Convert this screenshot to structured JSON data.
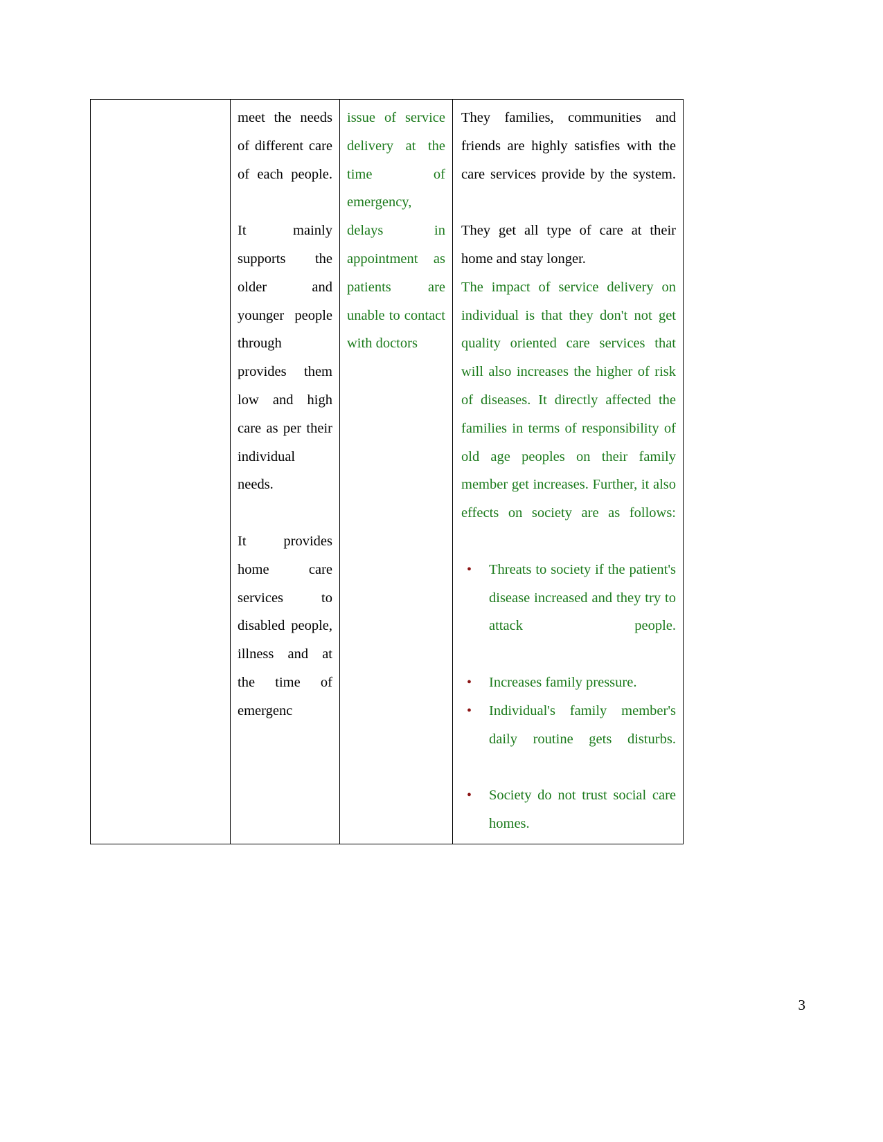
{
  "document": {
    "page_number": "3",
    "colors": {
      "body_text": "#000000",
      "green_text": "#1b7a1b",
      "bullet_marker": "#8c1515",
      "table_border": "#000000",
      "page_background": "#ffffff"
    }
  },
  "table": {
    "columns": [
      {
        "name": "column-1-empty",
        "content": ""
      },
      {
        "name": "column-2-black-text",
        "content": ""
      },
      {
        "name": "column-3-green-text",
        "content": ""
      },
      {
        "name": "column-4-main-text",
        "content": ""
      }
    ],
    "row": {
      "cell_1": {
        "text": ""
      },
      "cell_2": {
        "paragraph_1": "meet the needs of different care of each people.",
        "paragraph_2": "It mainly supports the older and younger people through provides them low and high care as per their individual needs.",
        "paragraph_3": "It provides home care services to disabled people, illness and at the time of emergenc"
      },
      "cell_3": {
        "paragraph_1": "issue of service delivery at the time of emergency, delays in appointment as patients are unable to contact with doctors"
      },
      "cell_4": {
        "paragraph_1": "They families, communities and friends are highly satisfies with the care services provide by the system.",
        "paragraph_2": "They get all type of care at their home and stay longer.",
        "paragraph_3": "The impact of service delivery on individual is that they don't not get quality oriented care services that will also increases the higher of risk of diseases. It directly affected the families in terms of responsibility of old age peoples on their family member get increases. Further, it also effects on society are as follows:",
        "bullets": [
          "Threats to society if the patient's disease increased and they try to attack people.",
          "Increases family pressure.",
          "Individual's family member's daily routine gets disturbs.",
          "Society do not trust social care homes."
        ],
        "bullet_marker_glyph": "•"
      }
    }
  }
}
